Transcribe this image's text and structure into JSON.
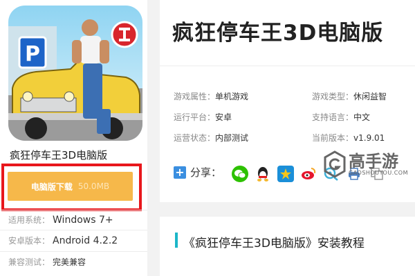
{
  "app": {
    "name": "疯狂停车王3D电脑版",
    "title": "疯狂停车王3D电脑版",
    "icon_badge": "P"
  },
  "download": {
    "label": "电脑版下载",
    "size": "50.0MB"
  },
  "left_info": [
    {
      "key": "适用系统：",
      "value": "Windows 7+"
    },
    {
      "key": "安卓版本：",
      "value": "Android 4.2.2"
    },
    {
      "key": "兼容测试：",
      "value": "完美兼容"
    }
  ],
  "attributes": [
    {
      "key": "游戏属性：",
      "value": "单机游戏"
    },
    {
      "key": "游戏类型：",
      "value": "休闲益智"
    },
    {
      "key": "运行平台：",
      "value": "安卓"
    },
    {
      "key": "支持语言：",
      "value": "中文"
    },
    {
      "key": "运营状态：",
      "value": "内部测试"
    },
    {
      "key": "当前版本：",
      "value": "v1.9.01"
    }
  ],
  "share": {
    "label": "分享：",
    "icons": [
      "wechat-icon",
      "qq-icon",
      "qzone-icon",
      "weibo-icon",
      "tencent-weibo-icon",
      "print-icon",
      "copy-icon"
    ]
  },
  "watermark": {
    "text": "高手游",
    "sub": "GAOSHOUYOU.COM"
  },
  "section": {
    "title": "《疯狂停车王3D电脑版》安装教程"
  },
  "colors": {
    "download_bg": "#f6b84a",
    "highlight_frame": "#e8171c",
    "section_accent": "#1cb6c8",
    "share_plus": "#3b8fe0"
  }
}
